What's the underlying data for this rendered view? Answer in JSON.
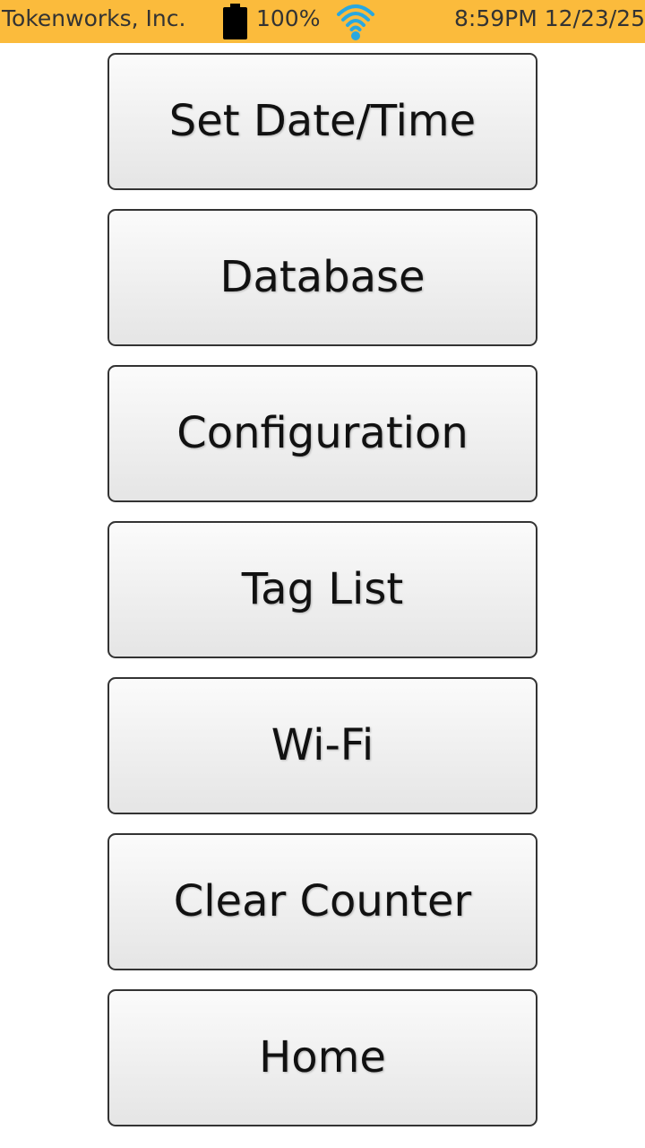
{
  "status_bar": {
    "company": "Tokenworks, Inc.",
    "battery": "100%",
    "datetime": "8:59PM 12/23/25",
    "background_color": "#fbbb3c",
    "wifi_color": "#29a8e0",
    "battery_icon": "battery-full-icon",
    "wifi_icon": "wifi-icon"
  },
  "menu": {
    "buttons": [
      {
        "label": "Set Date/Time"
      },
      {
        "label": "Database"
      },
      {
        "label": "Configuration"
      },
      {
        "label": "Tag List"
      },
      {
        "label": "Wi-Fi"
      },
      {
        "label": "Clear Counter"
      },
      {
        "label": "Home"
      }
    ]
  }
}
